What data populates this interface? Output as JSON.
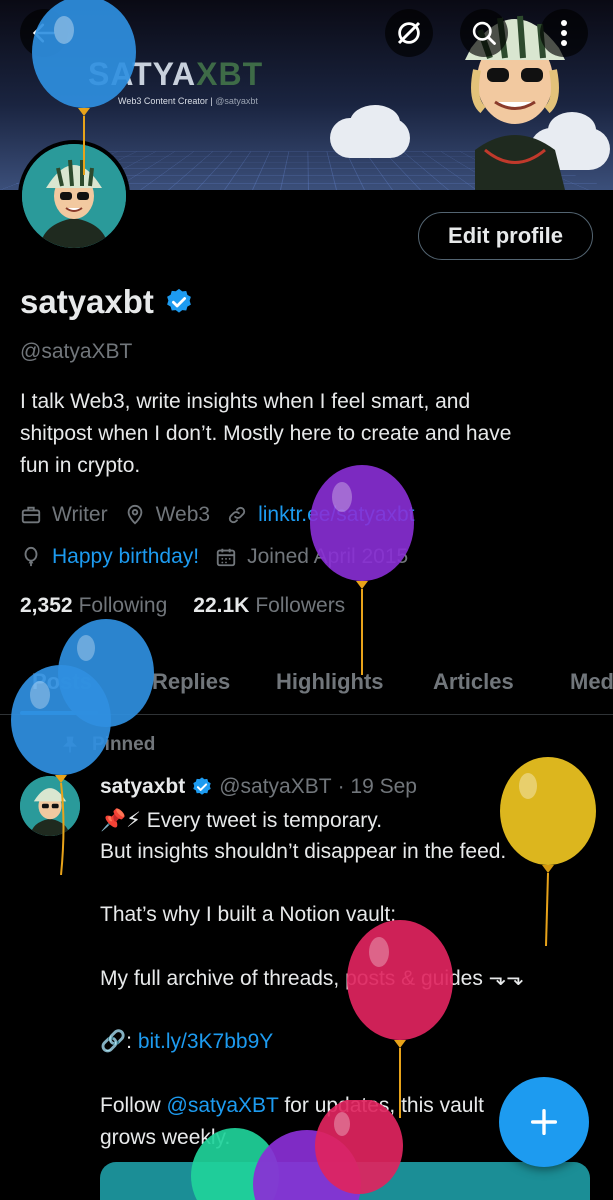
{
  "banner": {
    "brand_part1": "SATYA",
    "brand_part2": "XBT",
    "subtitle": "Web3 Content Creator |",
    "subtitle_handle": "@satyaxbt"
  },
  "header_icons": {
    "back": "back-arrow-icon",
    "grok": "grok-icon",
    "search": "search-icon",
    "more": "more-vertical-icon"
  },
  "profile": {
    "edit_label": "Edit profile",
    "display_name": "satyaxbt",
    "handle": "@satyaXBT",
    "bio_line1": "I talk Web3, write insights when I feel smart, and",
    "bio_line2": "shitpost when I don’t. Mostly here to create and have",
    "bio_line3": "fun in crypto.",
    "category": "Writer",
    "location": "Web3",
    "website": "linktr.ee/satyaxbt",
    "birthday": "Happy birthday!",
    "joined": "Joined April 2015",
    "following_count": "2,352",
    "following_label": "Following",
    "followers_count": "22.1K",
    "followers_label": "Followers"
  },
  "tabs": [
    "Posts",
    "Replies",
    "Highlights",
    "Articles",
    "Media"
  ],
  "tabs_visible": {
    "posts": "Posts",
    "replies": "Replies",
    "highlights": "Highlights",
    "articles": "Articles",
    "media": "Med"
  },
  "tweet": {
    "pinned_label": "Pinned",
    "name": "satyaxbt",
    "handle": "@satyaXBT",
    "date": "· 19 Sep",
    "line1": "📌⚡ Every tweet is temporary.",
    "line2": "But insights shouldn’t disappear in the feed.",
    "line3": "That’s why I built a Notion vault:",
    "line4": "My full archive of threads, posts & guides ⬎⬎",
    "line5_prefix": "🔗: ",
    "line5_link": "bit.ly/3K7bb9Y",
    "line6_prefix": "Follow ",
    "line6_mention": "@satyaXBT",
    "line6_suffix": " for updates, this vault",
    "line7": "grows weekly."
  },
  "fab": {
    "icon": "plus-icon"
  },
  "colors": {
    "accent": "#1d9bf0",
    "background": "#000000",
    "muted": "#71767b",
    "text": "#e7e9ea"
  }
}
